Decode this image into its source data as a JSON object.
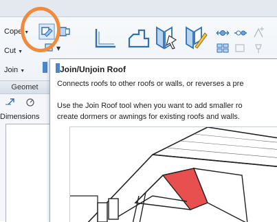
{
  "ribbon": {
    "tools": [
      {
        "label": "Cope"
      },
      {
        "label": "Cut"
      },
      {
        "label": "Join"
      }
    ],
    "panel_title": "Geomet",
    "properties_label": "Dimensions"
  },
  "tooltip": {
    "title": "Join/Unjoin Roof",
    "summary": "Connects roofs to other roofs or walls, or reverses a pre",
    "detail_line1": "Use the Join Roof tool when you want to add smaller ro",
    "detail_line2": "create dormers or awnings for existing roofs and walls."
  },
  "colors": {
    "highlight_ring": "#f08a3c",
    "roof_highlight": "#e85050",
    "icon_blue": "#2f6fb6"
  },
  "icons": [
    "join-roof-icon",
    "wall-sweep-icon",
    "opening-icon",
    "split-icon",
    "align-icon"
  ]
}
